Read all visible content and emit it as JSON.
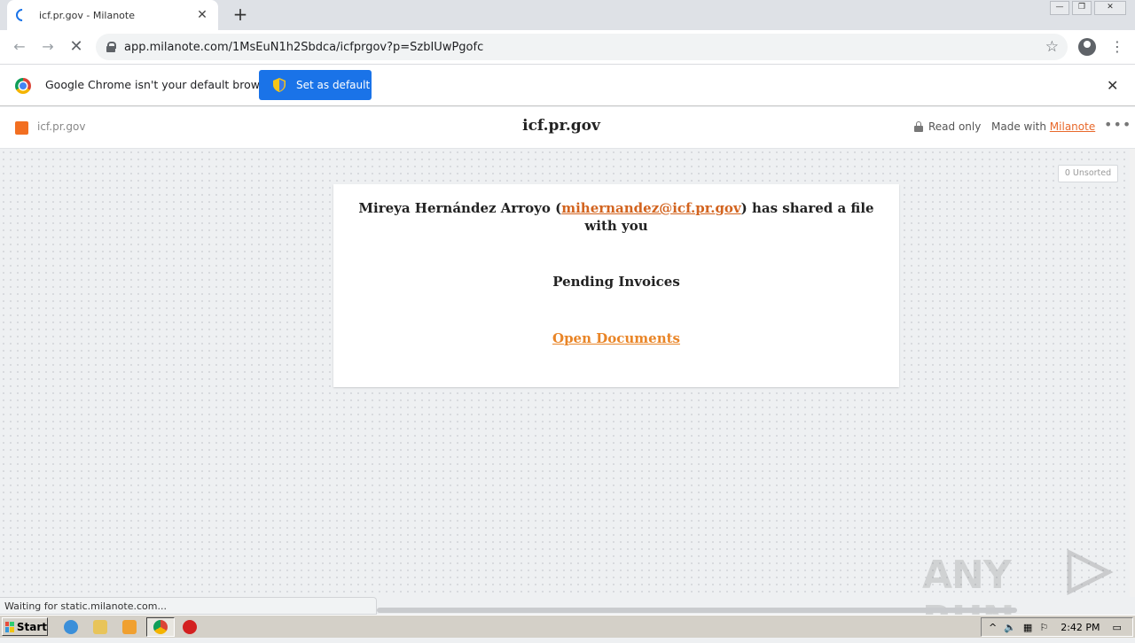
{
  "browser": {
    "tab_title": "icf.pr.gov - Milanote",
    "tab_close": "✕",
    "new_tab": "+",
    "url": "app.milanote.com/1MsEuN1h2Sbdca/icfprgov?p=SzbIUwPgofc"
  },
  "infobar": {
    "message": "Google Chrome isn't your default browser",
    "button_label": "Set as default",
    "close": "✕"
  },
  "board_header": {
    "board_name": "icf.pr.gov",
    "title": "icf.pr.gov",
    "read_only": "Read only",
    "made_with_prefix": "Made with ",
    "made_with_link": "Milanote",
    "more": "•••"
  },
  "canvas": {
    "unsorted_label": "0 Unsorted",
    "card": {
      "sender_name": "Mireya Hernández Arroyo (",
      "sender_email": "mihernandez@icf.pr.gov",
      "shared_text": ") has shared a file with you",
      "file_title": "Pending Invoices",
      "link_text": "Open Documents"
    }
  },
  "watermark": {
    "left": "ANY",
    "right": "RUN"
  },
  "status": {
    "text": "Waiting for static.milanote.com..."
  },
  "taskbar": {
    "start_label": "Start",
    "clock": "2:42 PM"
  },
  "colors": {
    "accent_orange": "#e8682a",
    "chrome_blue": "#1a73e8",
    "board_icon": "#f26f21"
  }
}
